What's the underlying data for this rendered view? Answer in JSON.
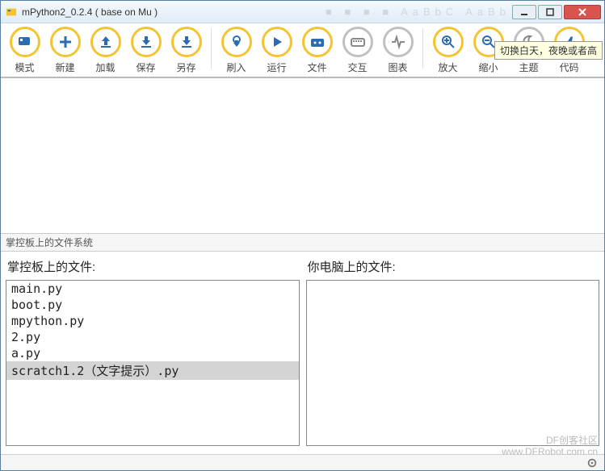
{
  "window": {
    "title": "mPython2_0.2.4 ( base on Mu )"
  },
  "titlebar_bg_hint": "■ ■ ■ ■   AaBbC  AaBb",
  "toolbar": [
    {
      "name": "mode",
      "label": "模式",
      "icon": "mode-icon"
    },
    {
      "name": "new",
      "label": "新建",
      "icon": "plus-icon"
    },
    {
      "name": "load",
      "label": "加载",
      "icon": "upload-icon"
    },
    {
      "name": "save",
      "label": "保存",
      "icon": "download-icon"
    },
    {
      "name": "saveas",
      "label": "另存",
      "icon": "download-icon"
    },
    {
      "sep": true
    },
    {
      "name": "flash",
      "label": "刷入",
      "icon": "chip-download-icon"
    },
    {
      "name": "run",
      "label": "运行",
      "icon": "play-icon"
    },
    {
      "name": "files",
      "label": "文件",
      "icon": "folder-icon"
    },
    {
      "name": "repl",
      "label": "交互",
      "icon": "keyboard-icon",
      "grey": true
    },
    {
      "name": "plot",
      "label": "图表",
      "icon": "pulse-icon",
      "grey": true
    },
    {
      "sep": true
    },
    {
      "name": "zoomin",
      "label": "放大",
      "icon": "zoom-in-icon"
    },
    {
      "name": "zoomout",
      "label": "缩小",
      "icon": "zoom-out-icon"
    },
    {
      "name": "theme",
      "label": "主题",
      "icon": "moon-icon",
      "grey": true
    },
    {
      "name": "code",
      "label": "代码",
      "icon": "thumb-icon"
    }
  ],
  "tooltip": "切换白天，夜晚或者高",
  "panel": {
    "header": "掌控板上的文件系统"
  },
  "left_files": {
    "title": "掌控板上的文件:",
    "items": [
      "main.py",
      "boot.py",
      "mpython.py",
      "2.py",
      "a.py",
      "scratch1.2（文字提示）.py"
    ],
    "selected_index": 5
  },
  "right_files": {
    "title": "你电脑上的文件:",
    "items": []
  },
  "watermark": {
    "line1": "DF创客社区",
    "line2": "www.DFRobot.com.cn"
  }
}
